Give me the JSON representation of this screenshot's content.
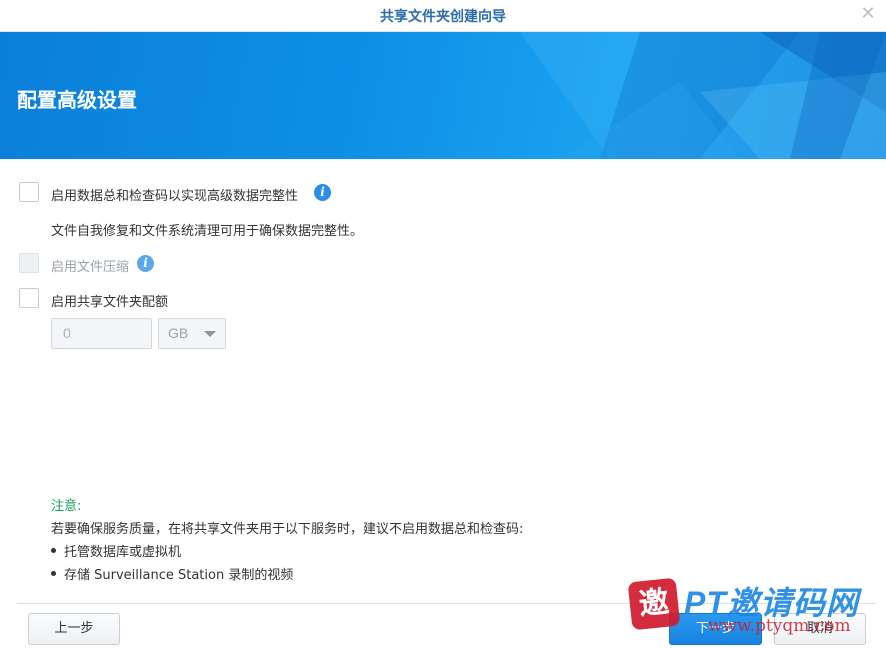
{
  "window": {
    "title": "共享文件夹创建向导",
    "close_icon": "close-icon"
  },
  "banner": {
    "heading": "配置高级设置"
  },
  "options": {
    "checksum": {
      "label": "启用数据总和检查码以实现高级数据完整性",
      "checked": false,
      "description": "文件自我修复和文件系统清理可用于确保数据完整性。"
    },
    "compression": {
      "label": "启用文件压缩",
      "checked": false,
      "disabled": true
    },
    "quota": {
      "label": "启用共享文件夹配额",
      "checked": false,
      "value": "0",
      "unit": "GB"
    }
  },
  "note": {
    "title": "注意:",
    "text": "若要确保服务质量，在将共享文件夹用于以下服务时，建议不启用数据总和检查码:",
    "bullets": [
      "托管数据库或虚拟机",
      "存储 Surveillance Station 录制的视频"
    ]
  },
  "footer": {
    "prev_label": "上一步",
    "next_label": "下一步",
    "cancel_label": "取消"
  },
  "watermark": {
    "seal_char": "邀",
    "text": "PT邀请码网",
    "url": "www.ptyqm.com"
  },
  "colors": {
    "accent": "#1684e0",
    "note": "#1aa05a"
  }
}
